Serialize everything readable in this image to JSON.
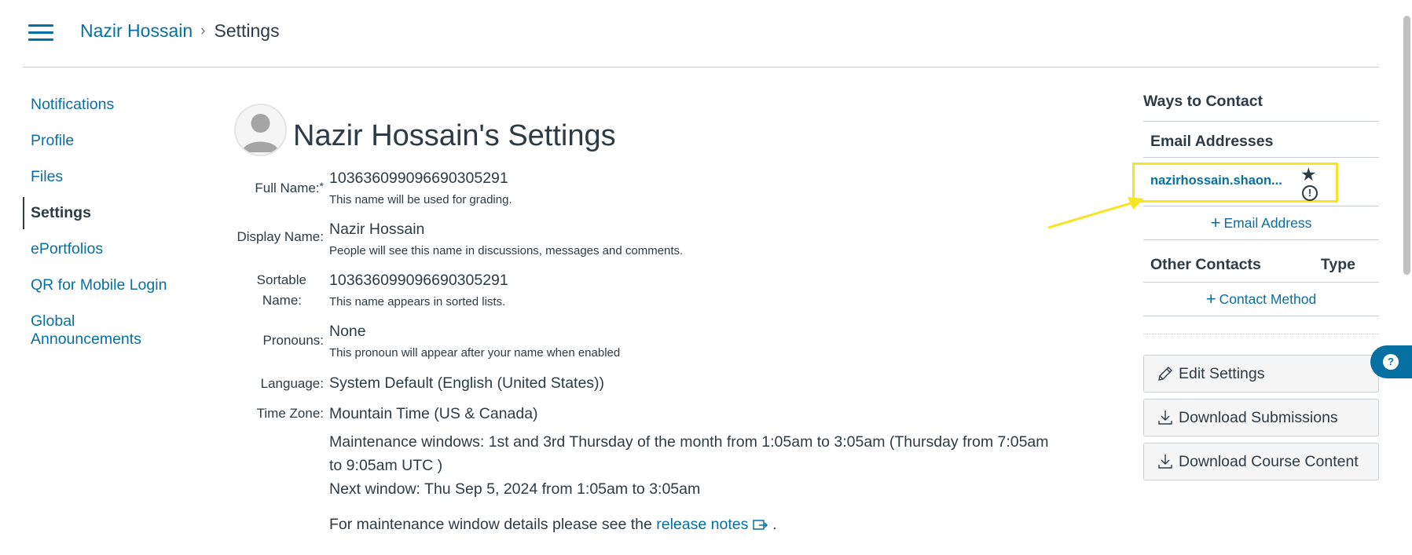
{
  "header": {
    "breadcrumb_user": "Nazir Hossain",
    "breadcrumb_separator": "›",
    "breadcrumb_current": "Settings"
  },
  "nav": {
    "items": [
      {
        "label": "Notifications"
      },
      {
        "label": "Profile"
      },
      {
        "label": "Files"
      },
      {
        "label": "Settings"
      },
      {
        "label": "ePortfolios"
      },
      {
        "label": "QR for Mobile Login"
      },
      {
        "label": "Global Announcements"
      }
    ]
  },
  "main": {
    "title": "Nazir Hossain's Settings",
    "full_name": {
      "label": "Full Name:",
      "required": "*",
      "value": "103636099096690305291",
      "hint": "This name will be used for grading."
    },
    "display_name": {
      "label": "Display Name:",
      "value": "Nazir Hossain",
      "hint": "People will see this name in discussions, messages and comments."
    },
    "sortable_name": {
      "label_1": "Sortable",
      "label_2": "Name:",
      "value": "103636099096690305291",
      "hint": "This name appears in sorted lists."
    },
    "pronouns": {
      "label": "Pronouns:",
      "value": "None",
      "hint": "This pronoun will appear after your name when enabled"
    },
    "language": {
      "label": "Language:",
      "value": "System Default (English (United States))"
    },
    "time_zone": {
      "label": "Time Zone:",
      "value": "Mountain Time (US & Canada)"
    },
    "maintenance": {
      "windows_line_1": "Maintenance windows: 1st and 3rd Thursday of the month from 1:05am to 3:05am (Thursday from 7:05am",
      "windows_line_2": "to 9:05am UTC )",
      "next_window": "Next window: Thu Sep 5, 2024 from 1:05am to 3:05am",
      "details_prefix": "For maintenance window details please see the",
      "details_link": "release notes",
      "details_suffix": "."
    }
  },
  "contact": {
    "title": "Ways to Contact",
    "email_heading": "Email Addresses",
    "email": "nazirhossain.shaon...",
    "add_email": "Email Address",
    "other_heading": "Other Contacts",
    "type_heading": "Type",
    "add_contact": "Contact Method"
  },
  "actions": {
    "edit_settings": "Edit Settings",
    "download_submissions": "Download Submissions",
    "download_course_content": "Download Course Content"
  },
  "colors": {
    "link": "#0770a3",
    "text": "#2d3b45",
    "highlight": "#f7e525"
  }
}
